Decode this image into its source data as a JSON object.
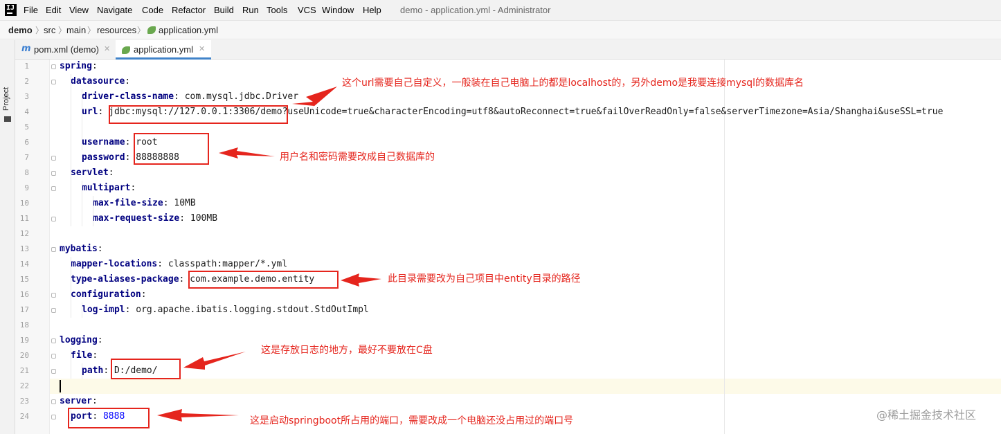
{
  "menubar": {
    "items": [
      "File",
      "Edit",
      "View",
      "Navigate",
      "Code",
      "Refactor",
      "Build",
      "Run",
      "Tools",
      "VCS",
      "Window",
      "Help"
    ],
    "window_title": "demo - application.yml - Administrator"
  },
  "breadcrumbs": [
    "demo",
    "src",
    "main",
    "resources",
    "application.yml"
  ],
  "sidebar": {
    "label": "Project"
  },
  "tabs": [
    {
      "label": "pom.xml (demo)",
      "icon": "maven-icon",
      "active": false
    },
    {
      "label": "application.yml",
      "icon": "yaml-leaf-icon",
      "active": true
    }
  ],
  "editor": {
    "caret_line": 22,
    "lines": [
      {
        "n": "1",
        "key": "spring",
        "sep": ":",
        "val": ""
      },
      {
        "n": "2",
        "key": "datasource",
        "sep": ":",
        "val": ""
      },
      {
        "n": "3",
        "key": "driver-class-name",
        "sep": ": ",
        "val": "com.mysql.jdbc.Driver"
      },
      {
        "n": "4",
        "key": "url",
        "sep": ": ",
        "val": "jdbc:mysql://127.0.0.1:3306/demo?useUnicode=true&characterEncoding=utf8&autoReconnect=true&failOverReadOnly=false&serverTimezone=Asia/Shanghai&useSSL=true"
      },
      {
        "n": "5",
        "key": "",
        "sep": "",
        "val": ""
      },
      {
        "n": "6",
        "key": "username",
        "sep": ": ",
        "val": "root"
      },
      {
        "n": "7",
        "key": "password",
        "sep": ": ",
        "val": "88888888"
      },
      {
        "n": "8",
        "key": "servlet",
        "sep": ":",
        "val": ""
      },
      {
        "n": "9",
        "key": "multipart",
        "sep": ":",
        "val": ""
      },
      {
        "n": "10",
        "key": "max-file-size",
        "sep": ": ",
        "val": "10MB"
      },
      {
        "n": "11",
        "key": "max-request-size",
        "sep": ": ",
        "val": "100MB"
      },
      {
        "n": "12",
        "key": "",
        "sep": "",
        "val": ""
      },
      {
        "n": "13",
        "key": "mybatis",
        "sep": ":",
        "val": ""
      },
      {
        "n": "14",
        "key": "mapper-locations",
        "sep": ": ",
        "val": "classpath:mapper/*.yml"
      },
      {
        "n": "15",
        "key": "type-aliases-package",
        "sep": ": ",
        "val": "com.example.demo.entity"
      },
      {
        "n": "16",
        "key": "configuration",
        "sep": ":",
        "val": ""
      },
      {
        "n": "17",
        "key": "log-impl",
        "sep": ": ",
        "val": "org.apache.ibatis.logging.stdout.StdOutImpl"
      },
      {
        "n": "18",
        "key": "",
        "sep": "",
        "val": ""
      },
      {
        "n": "19",
        "key": "logging",
        "sep": ":",
        "val": ""
      },
      {
        "n": "20",
        "key": "file",
        "sep": ":",
        "val": ""
      },
      {
        "n": "21",
        "key": "path",
        "sep": ": ",
        "val": "D:/demo/"
      },
      {
        "n": "22",
        "key": "",
        "sep": "",
        "val": ""
      },
      {
        "n": "23",
        "key": "server",
        "sep": ":",
        "val": ""
      },
      {
        "n": "24",
        "key": "port",
        "sep": ": ",
        "val": "8888"
      }
    ]
  },
  "annotations": [
    {
      "text": "这个url需要自己自定义，一般装在自己电脑上的都是localhost的，另外demo是我要连接mysql的数据库名"
    },
    {
      "text": "用户名和密码需要改成自己数据库的"
    },
    {
      "text": "此目录需要改为自己项目中entity目录的路径"
    },
    {
      "text": "这是存放日志的地方，最好不要放在C盘"
    },
    {
      "text": "这是启动springboot所占用的端口，需要改成一个电脑还没占用过的端口号"
    }
  ],
  "annotation_color": "#e5251d",
  "watermark": "@稀土掘金技术社区"
}
